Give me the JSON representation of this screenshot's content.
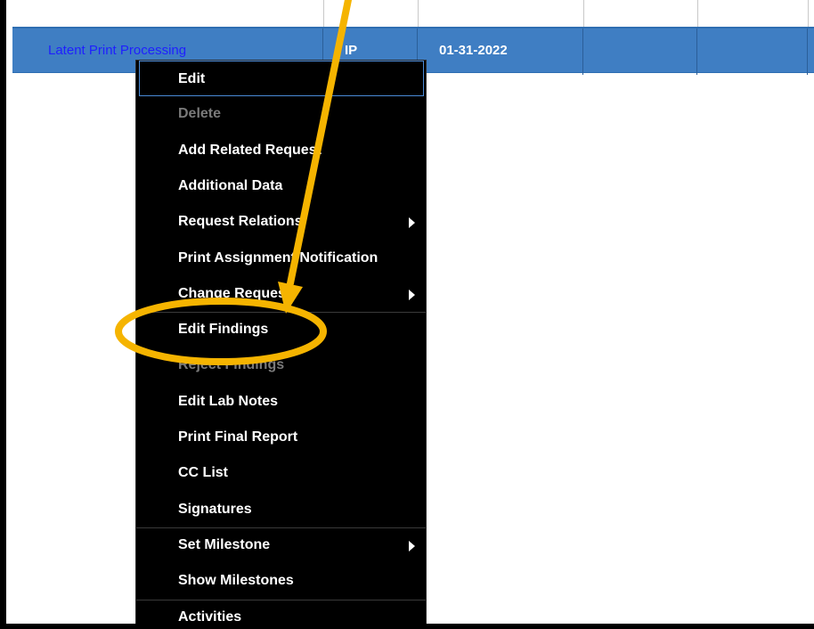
{
  "table_row": {
    "request_name": "Latent Print Processing",
    "status": "IP",
    "date": "01-31-2022"
  },
  "context_menu": {
    "items": [
      {
        "label": "Edit",
        "enabled": true,
        "submenu": false
      },
      {
        "label": "Delete",
        "enabled": false,
        "submenu": false
      },
      {
        "label": "Add Related Request",
        "enabled": true,
        "submenu": false
      },
      {
        "label": "Additional Data",
        "enabled": true,
        "submenu": false
      },
      {
        "label": "Request Relations",
        "enabled": true,
        "submenu": true
      },
      {
        "label": "Print Assignment Notification",
        "enabled": true,
        "submenu": false
      },
      {
        "label": "Change Request",
        "enabled": true,
        "submenu": true
      },
      {
        "label": "Edit Findings",
        "enabled": true,
        "submenu": false
      },
      {
        "label": "Reject Findings",
        "enabled": false,
        "submenu": false
      },
      {
        "label": "Edit Lab Notes",
        "enabled": true,
        "submenu": false
      },
      {
        "label": "Print Final Report",
        "enabled": true,
        "submenu": false
      },
      {
        "label": "CC List",
        "enabled": true,
        "submenu": false
      },
      {
        "label": "Signatures",
        "enabled": true,
        "submenu": false
      },
      {
        "label": "Set Milestone",
        "enabled": true,
        "submenu": true
      },
      {
        "label": "Show Milestones",
        "enabled": true,
        "submenu": false
      },
      {
        "label": "Activities",
        "enabled": true,
        "submenu": false
      }
    ]
  },
  "colors": {
    "row_background": "#3f7ec3",
    "menu_background": "#000000",
    "annotation": "#f5b400",
    "link": "#1f1fff"
  },
  "icons": {
    "submenu_arrow": "triangle-right",
    "annotation_arrow": "arrow-down"
  }
}
